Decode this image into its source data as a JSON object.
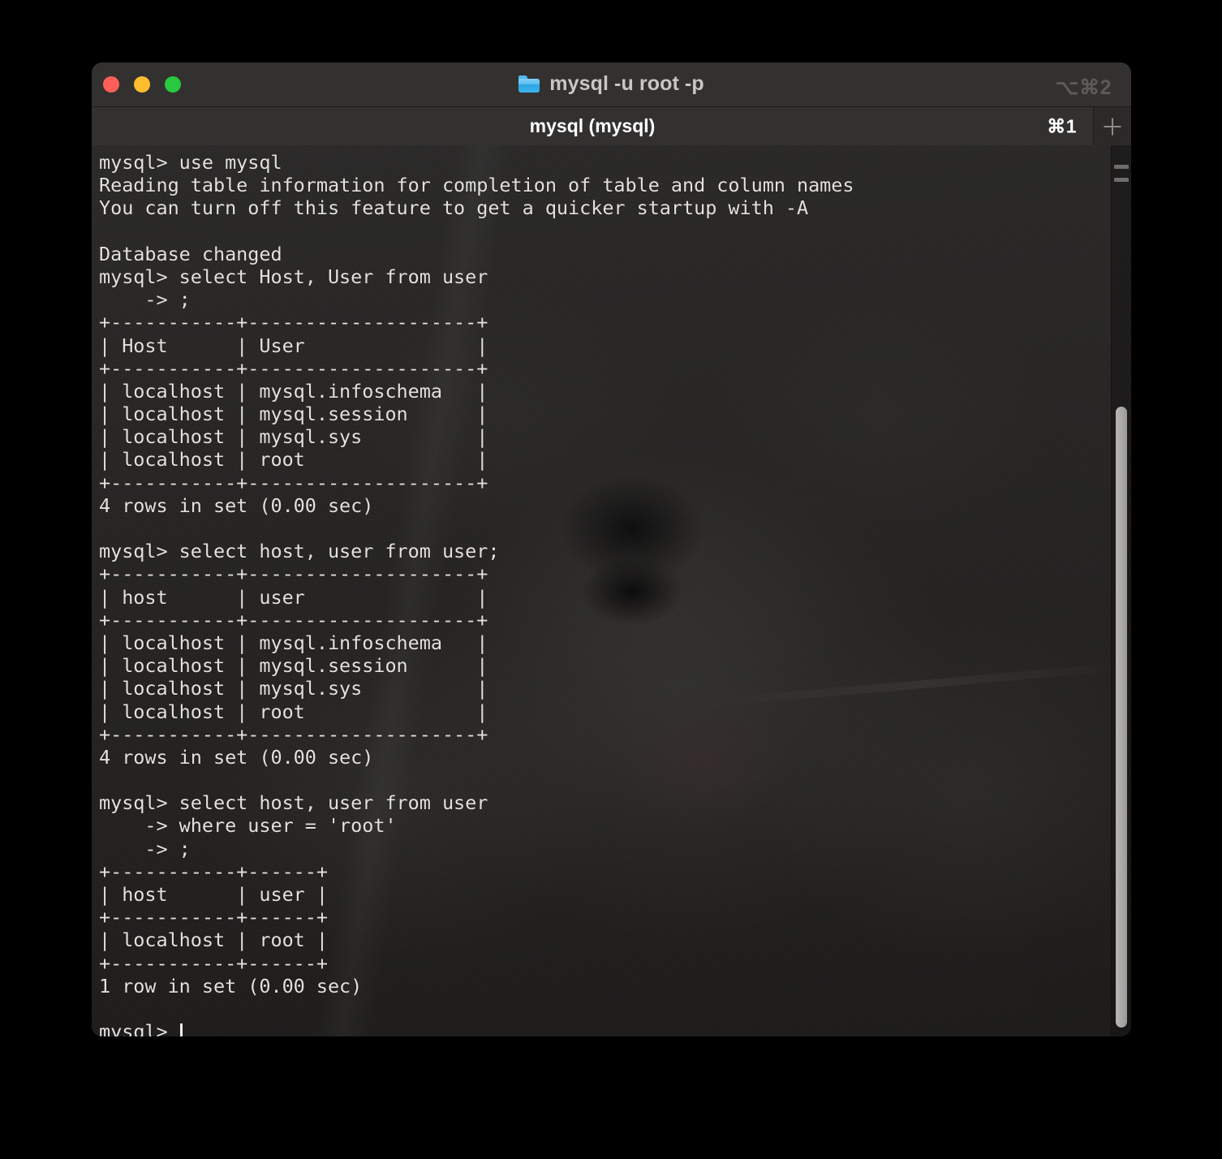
{
  "window": {
    "title": "mysql -u root -p",
    "title_shortcut": "⌥⌘2",
    "folder_icon": "folder-icon",
    "traffic_lights": {
      "close": "close-button",
      "minimize": "minimize-button",
      "maximize": "maximize-button"
    },
    "colors": {
      "close": "#ff5f57",
      "minimize": "#ffbd2e",
      "maximize": "#28c840",
      "titlebar_bg": "#333130",
      "terminal_bg": "#232221",
      "text": "#e3e1dd",
      "folder_blue": "#4fb7ef"
    }
  },
  "tabbar": {
    "active_tab_label": "mysql (mysql)",
    "tab_shortcut": "⌘1",
    "new_tab_label": "+"
  },
  "terminal": {
    "prompt": "mysql>",
    "continuation_prompt": "->",
    "lines": [
      "mysql> use mysql",
      "Reading table information for completion of table and column names",
      "You can turn off this feature to get a quicker startup with -A",
      "",
      "Database changed",
      "mysql> select Host, User from user",
      "    -> ;",
      "+-----------+--------------------+",
      "| Host      | User               |",
      "+-----------+--------------------+",
      "| localhost | mysql.infoschema   |",
      "| localhost | mysql.session      |",
      "| localhost | mysql.sys          |",
      "| localhost | root               |",
      "+-----------+--------------------+",
      "4 rows in set (0.00 sec)",
      "",
      "mysql> select host, user from user;",
      "+-----------+--------------------+",
      "| host      | user               |",
      "+-----------+--------------------+",
      "| localhost | mysql.infoschema   |",
      "| localhost | mysql.session      |",
      "| localhost | mysql.sys          |",
      "| localhost | root               |",
      "+-----------+--------------------+",
      "4 rows in set (0.00 sec)",
      "",
      "mysql> select host, user from user",
      "    -> where user = 'root'",
      "    -> ;",
      "+-----------+------+",
      "| host      | user |",
      "+-----------+------+",
      "| localhost | root |",
      "+-----------+------+",
      "1 row in set (0.00 sec)",
      "",
      "mysql> "
    ],
    "queries": [
      {
        "command": "use mysql",
        "output": [
          "Reading table information for completion of table and column names",
          "You can turn off this feature to get a quicker startup with -A",
          "Database changed"
        ]
      },
      {
        "command": "select Host, User from user ;",
        "columns": [
          "Host",
          "User"
        ],
        "rows": [
          [
            "localhost",
            "mysql.infoschema"
          ],
          [
            "localhost",
            "mysql.session"
          ],
          [
            "localhost",
            "mysql.sys"
          ],
          [
            "localhost",
            "root"
          ]
        ],
        "result_status": "4 rows in set (0.00 sec)"
      },
      {
        "command": "select host, user from user;",
        "columns": [
          "host",
          "user"
        ],
        "rows": [
          [
            "localhost",
            "mysql.infoschema"
          ],
          [
            "localhost",
            "mysql.session"
          ],
          [
            "localhost",
            "mysql.sys"
          ],
          [
            "localhost",
            "root"
          ]
        ],
        "result_status": "4 rows in set (0.00 sec)"
      },
      {
        "command": "select host, user from user where user = 'root' ;",
        "columns": [
          "host",
          "user"
        ],
        "rows": [
          [
            "localhost",
            "root"
          ]
        ],
        "result_status": "1 row in set (0.00 sec)"
      }
    ]
  },
  "scrollbar": {
    "thumb_color": "#b8b6b3",
    "marks": 2
  }
}
